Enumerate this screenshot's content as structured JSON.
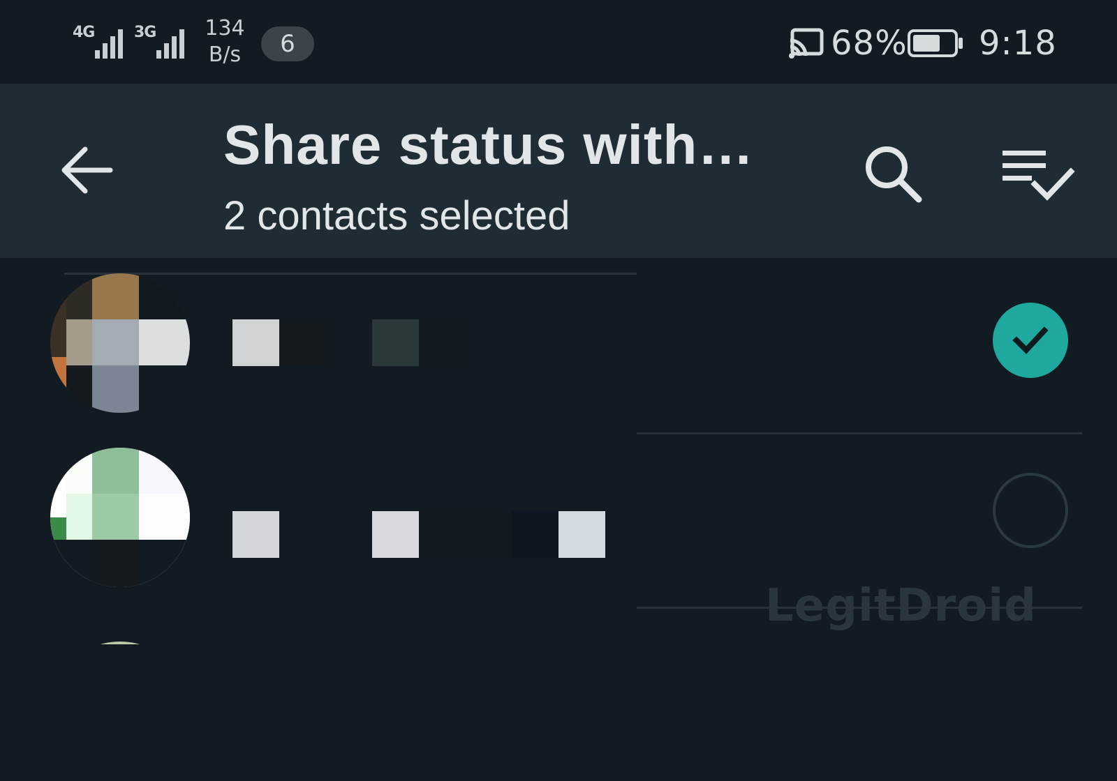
{
  "status_bar": {
    "net1": "4G",
    "net2": "3G",
    "speed_value": "134",
    "speed_unit": "B/s",
    "notification_count": "6",
    "battery_percent": "68%",
    "battery_level": 0.68,
    "time": "9:18"
  },
  "app_bar": {
    "title": "Share status with…",
    "subtitle": "2 contacts selected",
    "icons": [
      "back-arrow-icon",
      "search-icon",
      "select-all-icon"
    ]
  },
  "contacts": [
    {
      "name": "",
      "selected": true
    },
    {
      "name": "",
      "selected": false
    },
    {
      "name": "",
      "selected": false
    }
  ],
  "colors": {
    "background": "#111b21",
    "app_bar": "#202c33",
    "accent": "#1fa89d"
  },
  "watermark": "LegitDroid"
}
